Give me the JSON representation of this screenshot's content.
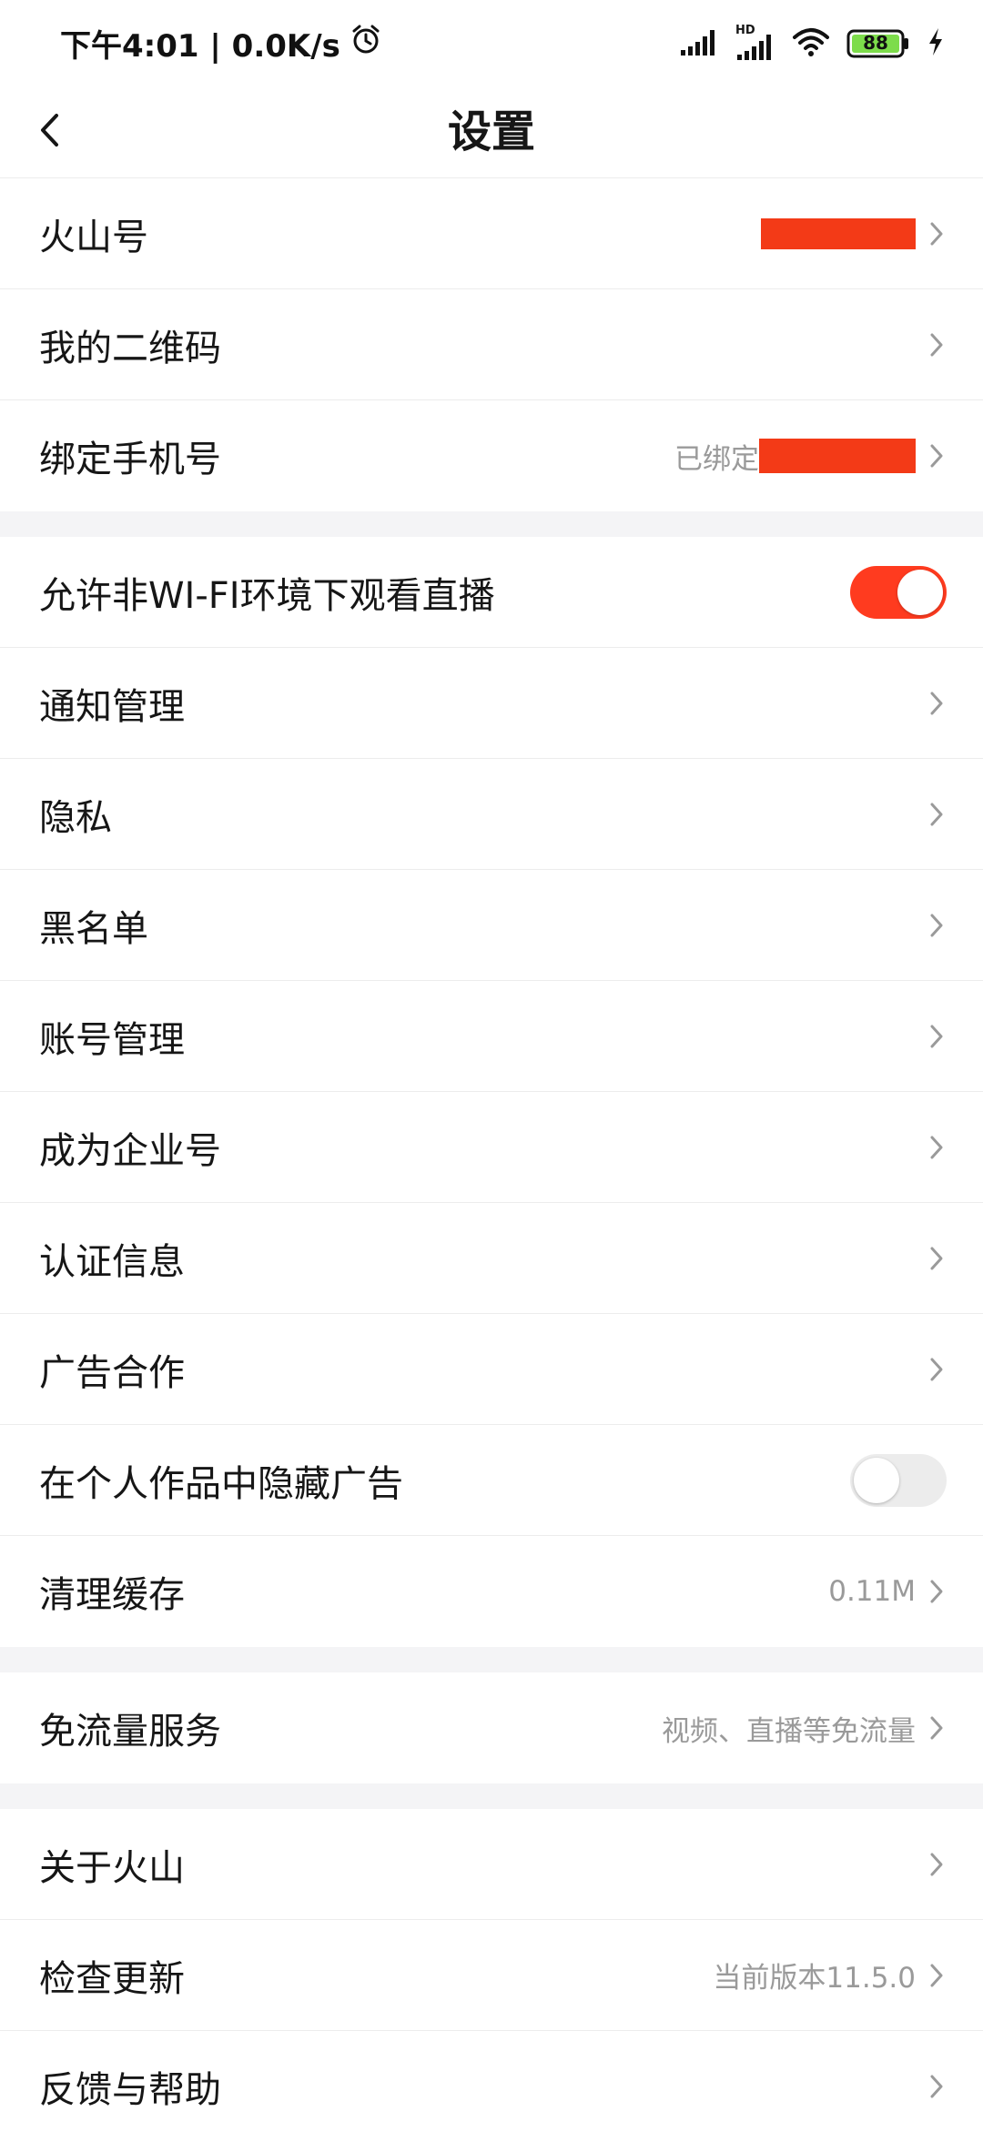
{
  "status": {
    "time_net": "下午4:01 | 0.0K/s",
    "hd_label": "HD",
    "battery": "88",
    "icons": [
      "alarm-icon",
      "signal-icon",
      "hd-signal-icon",
      "wifi-icon",
      "battery-icon",
      "charging-icon"
    ]
  },
  "nav": {
    "title": "设置",
    "back_icon": "chevron-left-icon"
  },
  "groups": {
    "account": {
      "huoshan_id": {
        "label": "火山号",
        "value": ""
      },
      "qr_code": {
        "label": "我的二维码"
      },
      "bind_phone": {
        "label": "绑定手机号",
        "value": "已绑定"
      }
    },
    "general": {
      "wifi_live": {
        "label": "允许非WI-FI环境下观看直播",
        "enabled": true
      },
      "notifications": {
        "label": "通知管理"
      },
      "privacy": {
        "label": "隐私"
      },
      "blacklist": {
        "label": "黑名单"
      },
      "account_mgmt": {
        "label": "账号管理"
      },
      "enterprise": {
        "label": "成为企业号"
      },
      "verification": {
        "label": "认证信息"
      },
      "ad_coop": {
        "label": "广告合作"
      },
      "hide_ads": {
        "label": "在个人作品中隐藏广告",
        "enabled": false
      },
      "clear_cache": {
        "label": "清理缓存",
        "value": "0.11M"
      }
    },
    "traffic": {
      "free_data": {
        "label": "免流量服务",
        "value": "视频、直播等免流量"
      }
    },
    "about": {
      "about_app": {
        "label": "关于火山"
      },
      "check_update": {
        "label": "检查更新",
        "value": "当前版本11.5.0"
      },
      "feedback": {
        "label": "反馈与帮助"
      }
    }
  },
  "colors": {
    "accent": "#ff3b1f",
    "redaction": "#f33a17",
    "toggle_off": "#ececec",
    "divider": "#ececec",
    "section_gap": "#f4f4f6",
    "secondary_text": "#9a9a9a",
    "battery_fill": "#7ddc4b"
  }
}
